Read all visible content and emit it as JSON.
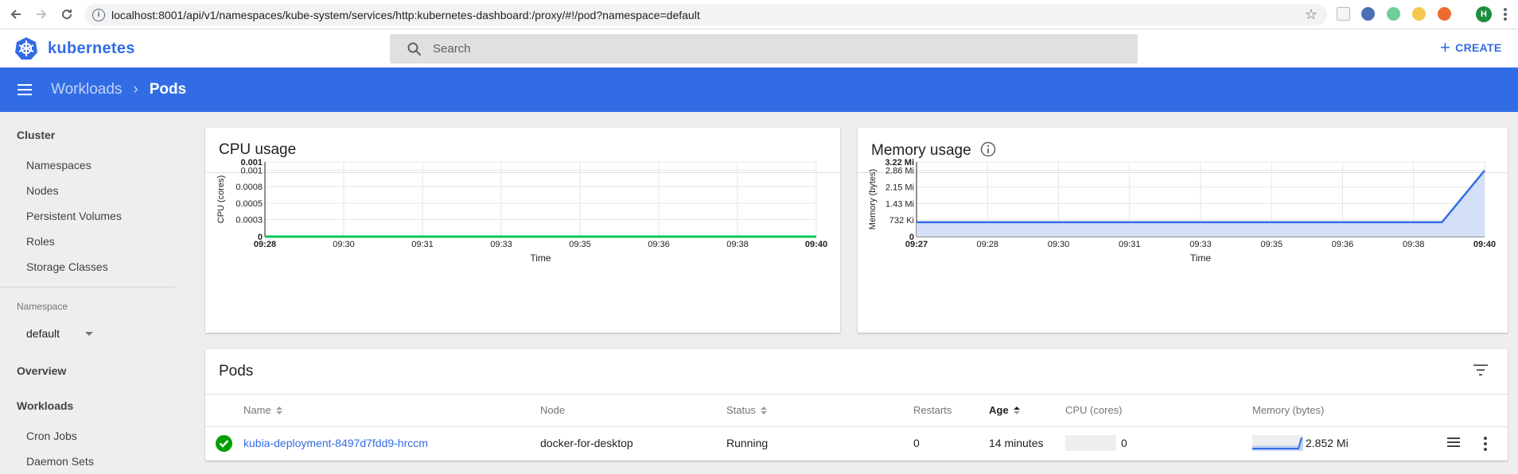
{
  "browser": {
    "url": "localhost:8001/api/v1/namespaces/kube-system/services/http:kubernetes-dashboard:/proxy/#!/pod?namespace=default",
    "avatar_letter": "H"
  },
  "header": {
    "logo_text": "kubernetes",
    "search_placeholder": "Search",
    "create_label": "CREATE"
  },
  "toolbar": {
    "breadcrumb_parent": "Workloads",
    "breadcrumb_current": "Pods"
  },
  "sidebar": {
    "cluster_heading": "Cluster",
    "cluster_items": [
      "Namespaces",
      "Nodes",
      "Persistent Volumes",
      "Roles",
      "Storage Classes"
    ],
    "namespace_label": "Namespace",
    "namespace_value": "default",
    "overview": "Overview",
    "workloads_heading": "Workloads",
    "workload_items": [
      "Cron Jobs",
      "Daemon Sets"
    ]
  },
  "cpu_card": {
    "title": "CPU usage"
  },
  "memory_card": {
    "title": "Memory usage"
  },
  "chart_data": [
    {
      "type": "line",
      "title": "CPU usage",
      "xlabel": "Time",
      "ylabel": "CPU (cores)",
      "x_ticks": [
        "09:28",
        "09:30",
        "09:31",
        "09:33",
        "09:35",
        "09:36",
        "09:38",
        "09:40"
      ],
      "y_ticks": [
        "0",
        "0.0003",
        "0.0005",
        "0.0008",
        "0.001",
        "0.001"
      ],
      "ylim": [
        0,
        0.0012
      ],
      "grid": true,
      "series": [
        {
          "values": [
            0,
            0,
            0,
            0,
            0,
            0,
            0,
            0
          ],
          "color": "#00c853"
        }
      ]
    },
    {
      "type": "area",
      "title": "Memory usage",
      "xlabel": "Time",
      "ylabel": "Memory (bytes)",
      "x_ticks": [
        "09:27",
        "09:28",
        "09:30",
        "09:31",
        "09:33",
        "09:35",
        "09:36",
        "09:38",
        "09:40"
      ],
      "y_ticks": [
        "0",
        "732 Ki",
        "1.43 Mi",
        "2.15 Mi",
        "2.86 Mi",
        "3.22 Mi"
      ],
      "ylim": [
        0,
        3.22
      ],
      "y_unit": "Mi",
      "grid": true,
      "series": [
        {
          "values": [
            0.62,
            0.62,
            0.62,
            0.62,
            0.62,
            0.62,
            0.62,
            0.62,
            0.62,
            2.852
          ],
          "x_pos": [
            0,
            1,
            2,
            3,
            4,
            5,
            6,
            7,
            7.4,
            8
          ],
          "color": "#326ce5"
        }
      ]
    }
  ],
  "pods": {
    "title": "Pods",
    "columns": [
      "Name",
      "Node",
      "Status",
      "Restarts",
      "Age",
      "CPU (cores)",
      "Memory (bytes)"
    ],
    "rows": [
      {
        "name": "kubia-deployment-8497d7fdd9-hrccm",
        "node": "docker-for-desktop",
        "status": "Running",
        "restarts": "0",
        "age": "14 minutes",
        "cpu": "0",
        "memory": "2.852 Mi"
      }
    ]
  },
  "colors": {
    "brand": "#326ce5",
    "ok": "#00a000",
    "cpu_line": "#00c853"
  }
}
